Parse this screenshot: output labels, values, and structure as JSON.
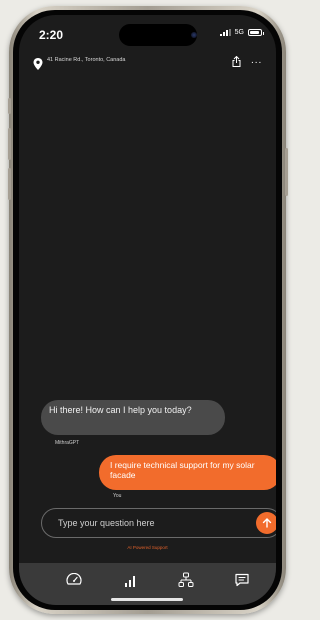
{
  "status_bar": {
    "time": "2:20",
    "network": "5G",
    "signal_level": 3,
    "battery_level": 0.85
  },
  "header": {
    "location": "41 Racine Rd., Toronto, Canada",
    "share_icon": "share-icon",
    "more_label": "..."
  },
  "chat": {
    "messages": [
      {
        "role": "bot",
        "text": "Hi there! How can I help you today?",
        "sender": "MithraGPT"
      },
      {
        "role": "user",
        "text": "I require technical support for my solar facade",
        "sender": "You"
      }
    ]
  },
  "composer": {
    "placeholder": "Type your question here",
    "value": "",
    "send_icon": "arrow-up-icon"
  },
  "footer_note": "AI Powered Support",
  "bottom_nav": {
    "items": [
      {
        "name": "dashboard-icon"
      },
      {
        "name": "analytics-icon"
      },
      {
        "name": "network-icon"
      },
      {
        "name": "chat-icon"
      }
    ]
  },
  "colors": {
    "accent": "#f26c2c",
    "screen_bg": "#1c1c1c",
    "bot_bubble": "#4a4a4a",
    "nav_bg": "#3a3a3a"
  }
}
